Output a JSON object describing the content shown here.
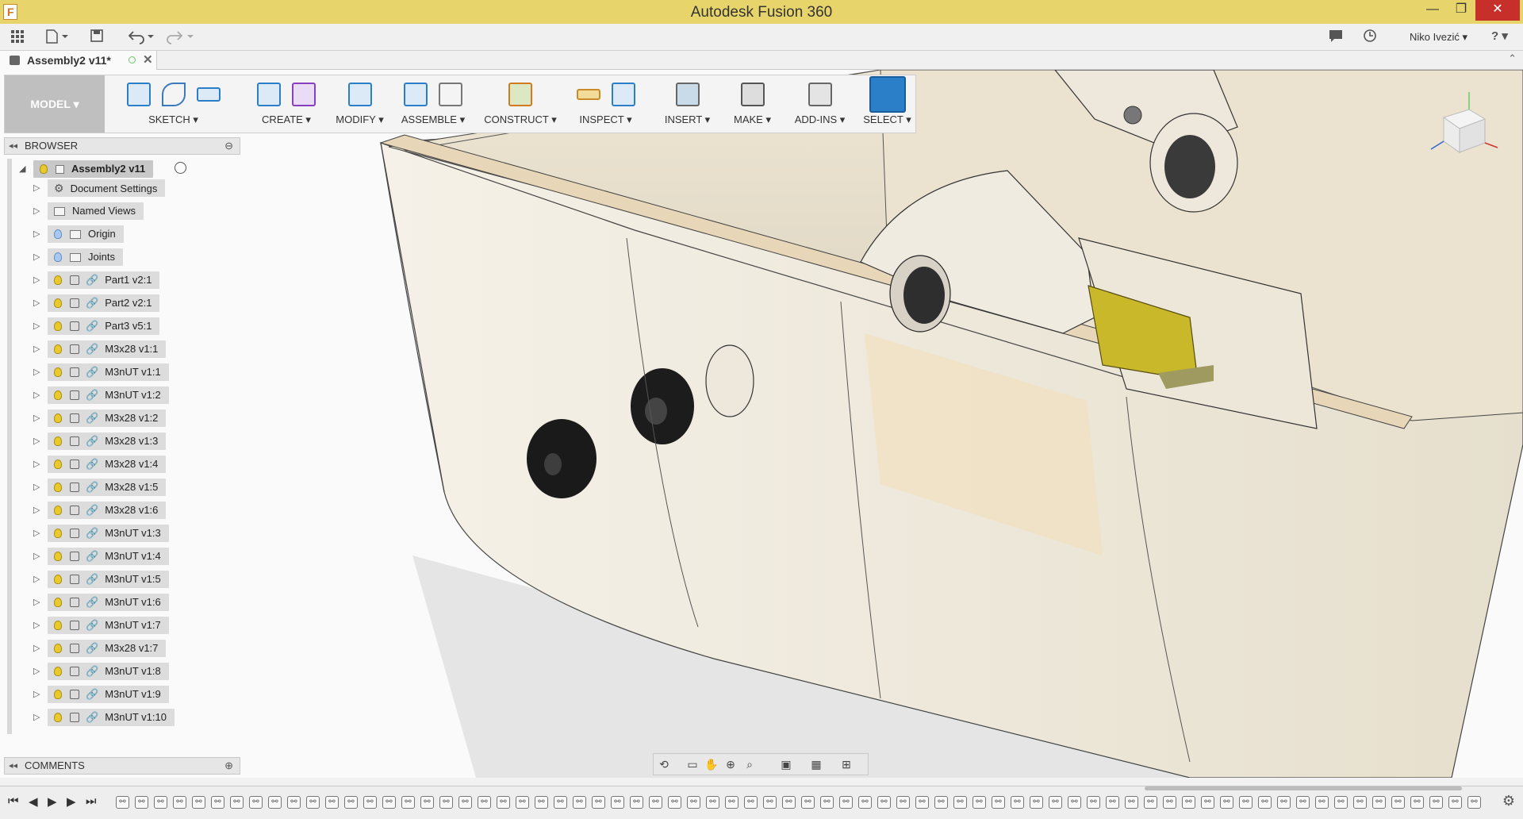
{
  "window": {
    "title": "Autodesk Fusion 360",
    "minimize": "—",
    "restore": "❐",
    "close": "✕"
  },
  "qat": {
    "user": "Niko Ivezić ▾",
    "help": "? ▾"
  },
  "doc_tab": {
    "name": "Assembly2 v11*",
    "close": "✕"
  },
  "toolbar": {
    "model": "MODEL ▾",
    "sketch": "SKETCH ▾",
    "create": "CREATE ▾",
    "modify": "MODIFY ▾",
    "assemble": "ASSEMBLE ▾",
    "construct": "CONSTRUCT ▾",
    "inspect": "INSPECT ▾",
    "insert": "INSERT ▾",
    "make": "MAKE ▾",
    "addins": "ADD-INS ▾",
    "select": "SELECT ▾"
  },
  "browser": {
    "title": "BROWSER",
    "root": "Assembly2 v11",
    "items": [
      {
        "label": "Document Settings",
        "kind": "settings"
      },
      {
        "label": "Named Views",
        "kind": "folder"
      },
      {
        "label": "Origin",
        "kind": "folder-bulb"
      },
      {
        "label": "Joints",
        "kind": "folder-bulb"
      },
      {
        "label": "Part1 v2:1",
        "kind": "component"
      },
      {
        "label": "Part2 v2:1",
        "kind": "component"
      },
      {
        "label": "Part3 v5:1",
        "kind": "component"
      },
      {
        "label": "M3x28 v1:1",
        "kind": "component"
      },
      {
        "label": "M3nUT v1:1",
        "kind": "component"
      },
      {
        "label": "M3nUT v1:2",
        "kind": "component"
      },
      {
        "label": "M3x28 v1:2",
        "kind": "component"
      },
      {
        "label": "M3x28 v1:3",
        "kind": "component"
      },
      {
        "label": "M3x28 v1:4",
        "kind": "component"
      },
      {
        "label": "M3x28 v1:5",
        "kind": "component"
      },
      {
        "label": "M3x28 v1:6",
        "kind": "component"
      },
      {
        "label": "M3nUT v1:3",
        "kind": "component"
      },
      {
        "label": "M3nUT v1:4",
        "kind": "component"
      },
      {
        "label": "M3nUT v1:5",
        "kind": "component"
      },
      {
        "label": "M3nUT v1:6",
        "kind": "component"
      },
      {
        "label": "M3nUT v1:7",
        "kind": "component"
      },
      {
        "label": "M3x28 v1:7",
        "kind": "component"
      },
      {
        "label": "M3nUT v1:8",
        "kind": "component"
      },
      {
        "label": "M3nUT v1:9",
        "kind": "component"
      },
      {
        "label": "M3nUT v1:10",
        "kind": "component"
      }
    ]
  },
  "comments": {
    "title": "COMMENTS"
  },
  "colors": {
    "titlebar": "#e7d56c",
    "accent": "#2b7fc9",
    "model_part": "#ede6d6",
    "yellow_part": "#c9b82a"
  }
}
